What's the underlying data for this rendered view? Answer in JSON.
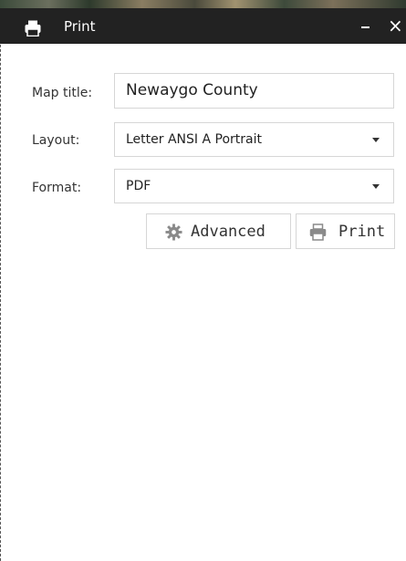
{
  "window": {
    "title": "Print",
    "close_glyph": "×"
  },
  "form": {
    "map_title": {
      "label": "Map title:",
      "value": "Newaygo County"
    },
    "layout": {
      "label": "Layout:",
      "value": "Letter ANSI A Portrait"
    },
    "format": {
      "label": "Format:",
      "value": "PDF"
    }
  },
  "buttons": {
    "advanced": {
      "label": "Advanced",
      "icon": "gear-icon"
    },
    "print": {
      "label": "Print",
      "icon": "printer-icon"
    }
  },
  "icons": {
    "header": "printer-icon",
    "minimize": "minimize-icon",
    "close": "close-icon",
    "dropdown": "chevron-down-icon"
  },
  "colors": {
    "header_bg": "#222222",
    "header_text": "#ffffff",
    "border": "#d6d6d6",
    "text": "#333333",
    "icon_gray": "#8a8a8a"
  }
}
